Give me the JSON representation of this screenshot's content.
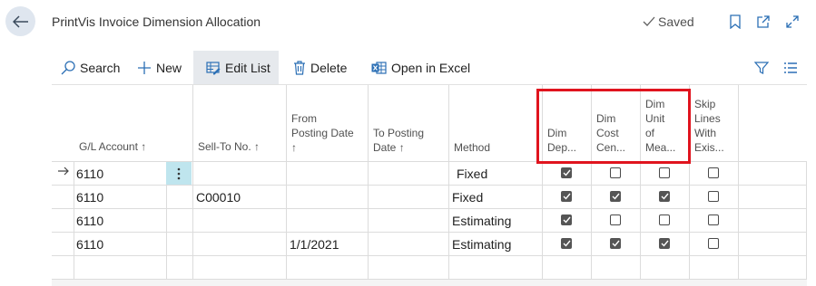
{
  "header": {
    "title": "PrintVis Invoice Dimension Allocation",
    "saved_label": "Saved"
  },
  "toolbar": {
    "search": "Search",
    "new": "New",
    "edit_list": "Edit List",
    "delete": "Delete",
    "open_excel": "Open in Excel"
  },
  "columns": {
    "gl_account": "G/L Account",
    "sell_to_no": "Sell-To No.",
    "from_posting_date_1": "From",
    "from_posting_date_2": "Posting Date",
    "to_posting_date_1": "To Posting",
    "to_posting_date_2": "Date",
    "method": "Method",
    "dim_dep_1": "Dim",
    "dim_dep_2": "Dep...",
    "dim_cost_1": "Dim",
    "dim_cost_2": "Cost",
    "dim_cost_3": "Cen...",
    "dim_unit_1": "Dim",
    "dim_unit_2": "Unit",
    "dim_unit_3": "of",
    "dim_unit_4": "Mea...",
    "skip_1": "Skip",
    "skip_2": "Lines",
    "skip_3": "With",
    "skip_4": "Exis..."
  },
  "sort_arrow": "↑",
  "rows": [
    {
      "gl_account": "6110",
      "sell_to_no": "",
      "from_date": "",
      "to_date": "",
      "method": "Fixed",
      "dim_dep": true,
      "dim_cost": false,
      "dim_unit": false,
      "skip": false
    },
    {
      "gl_account": "6110",
      "sell_to_no": "C00010",
      "from_date": "",
      "to_date": "",
      "method": "Fixed",
      "dim_dep": true,
      "dim_cost": true,
      "dim_unit": true,
      "skip": false
    },
    {
      "gl_account": "6110",
      "sell_to_no": "",
      "from_date": "",
      "to_date": "",
      "method": "Estimating",
      "dim_dep": true,
      "dim_cost": false,
      "dim_unit": false,
      "skip": false
    },
    {
      "gl_account": "6110",
      "sell_to_no": "",
      "from_date": "1/1/2021",
      "to_date": "",
      "method": "Estimating",
      "dim_dep": true,
      "dim_cost": true,
      "dim_unit": true,
      "skip": false
    }
  ]
}
